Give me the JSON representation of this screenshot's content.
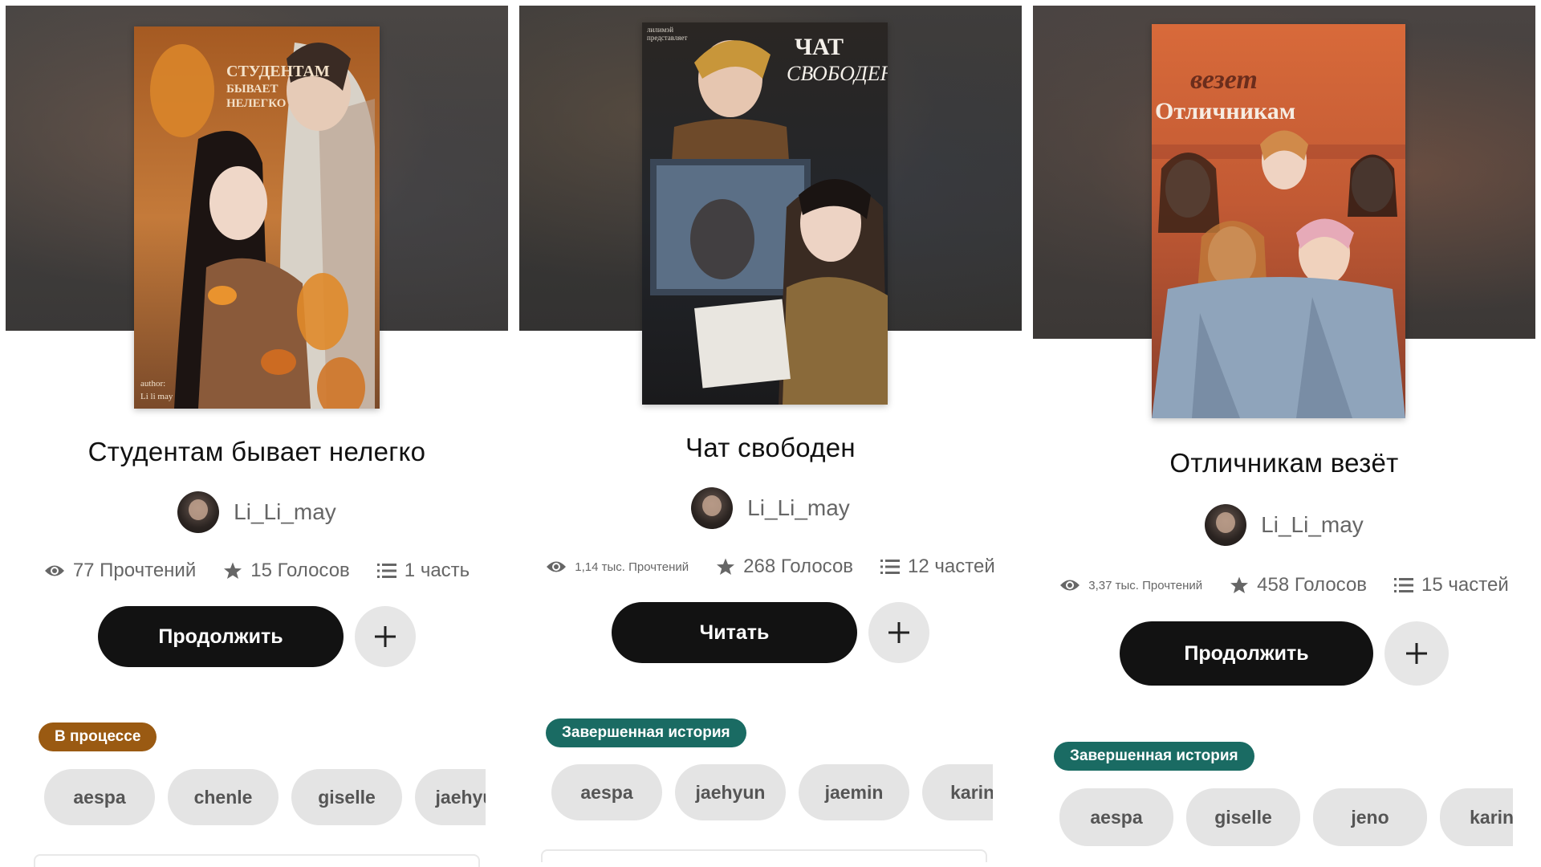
{
  "stories": [
    {
      "title": "Студентам бывает нелегко",
      "author": "Li_Li_may",
      "reads": "77 Прочтений",
      "votes": "15 Голосов",
      "parts": "1 часть",
      "primary_action": "Продолжить",
      "status": "В процессе",
      "status_color": "#9a5a12",
      "tags": [
        "aespa",
        "chenle",
        "giselle",
        "jaehyun"
      ],
      "cover": {
        "title_lines": [
          "СТУДЕНТАМ",
          "БЫВАЕТ",
          "НЕЛЕГКО"
        ],
        "credit_lines": [
          "author:",
          "Li li may"
        ]
      }
    },
    {
      "title": "Чат свободен",
      "author": "Li_Li_may",
      "reads": "1,14 тыс. Прочтений",
      "votes": "268 Голосов",
      "parts": "12 частей",
      "primary_action": "Читать",
      "status": "Завершенная история",
      "status_color": "#1a6b63",
      "tags": [
        "aespa",
        "jaehyun",
        "jaemin",
        "karina"
      ],
      "cover": {
        "title_lines": [
          "ЧАТ",
          "СВОБОДЕН"
        ],
        "credit_lines": [
          "лилимэй",
          "представляет"
        ]
      }
    },
    {
      "title": "Отличникам везёт",
      "author": "Li_Li_may",
      "reads": "3,37 тыс. Прочтений",
      "votes": "458 Голосов",
      "parts": "15 частей",
      "primary_action": "Продолжить",
      "status": "Завершенная история",
      "status_color": "#1a6b63",
      "tags": [
        "aespa",
        "giselle",
        "jeno",
        "karina"
      ],
      "cover": {
        "title_lines": [
          "везет",
          "Отличникам"
        ],
        "credit_lines": []
      }
    }
  ],
  "icons": {
    "reads": "eye-icon",
    "votes": "star-icon",
    "parts": "list-icon",
    "add": "plus-icon"
  }
}
